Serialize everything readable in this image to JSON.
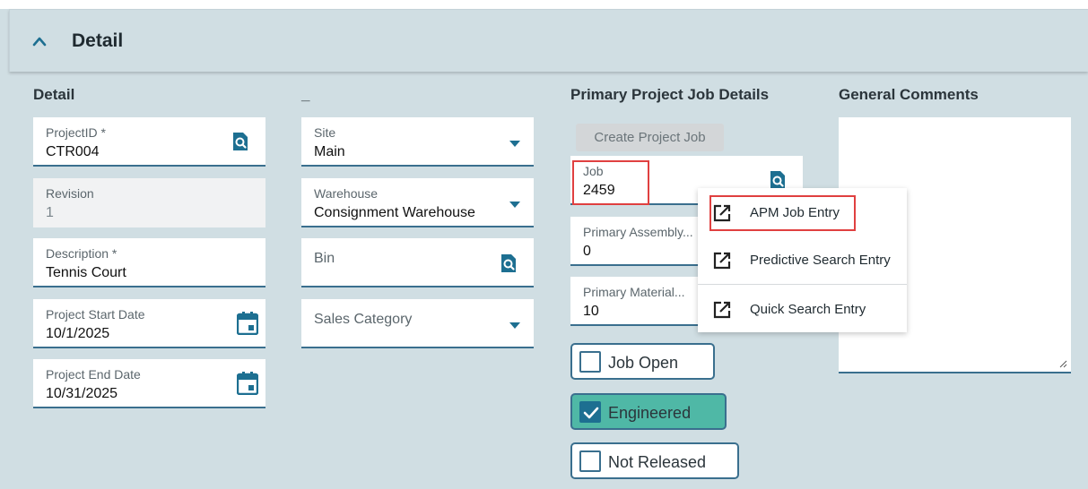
{
  "panel": {
    "title": "Detail"
  },
  "columns": {
    "detail": "Detail",
    "second": "_",
    "job": "Primary Project Job Details",
    "comments": "General Comments"
  },
  "detail_fields": {
    "project_id": {
      "label": "ProjectID *",
      "value": "CTR004"
    },
    "revision": {
      "label": "Revision",
      "value": "1"
    },
    "description": {
      "label": "Description *",
      "value": "Tennis Court"
    },
    "start_date": {
      "label": "Project Start Date",
      "value": "10/1/2025"
    },
    "end_date": {
      "label": "Project End Date",
      "value": "10/31/2025"
    }
  },
  "site_fields": {
    "site": {
      "label": "Site",
      "value": "Main"
    },
    "warehouse": {
      "label": "Warehouse",
      "value": "Consignment Warehouse"
    },
    "bin": {
      "label": "Bin",
      "value": ""
    },
    "sales_category": {
      "label": "Sales Category",
      "value": ""
    }
  },
  "job_details": {
    "create_button": "Create Project Job",
    "job": {
      "label": "Job",
      "value": "2459"
    },
    "primary_assembly": {
      "label": "Primary Assembly...",
      "value": "0"
    },
    "primary_material": {
      "label": "Primary Material...",
      "value": "10"
    },
    "checkboxes": {
      "job_open": {
        "label": "Job Open",
        "checked": false
      },
      "engineered": {
        "label": "Engineered",
        "checked": true
      },
      "not_released": {
        "label": "Not Released",
        "checked": false
      }
    }
  },
  "context_menu": {
    "items": [
      {
        "label": "APM Job Entry",
        "icon": "open-external-icon"
      },
      {
        "label": "Predictive Search Entry",
        "icon": "open-external-icon"
      },
      {
        "label": "Quick Search Entry",
        "icon": "open-external-icon"
      }
    ]
  },
  "comments": {
    "value": ""
  },
  "colors": {
    "accent": "#1d6f91",
    "underline": "#3a6f8e",
    "checked_fill": "#4fb8a6",
    "highlight": "#e04040",
    "background": "#d0dee3"
  }
}
